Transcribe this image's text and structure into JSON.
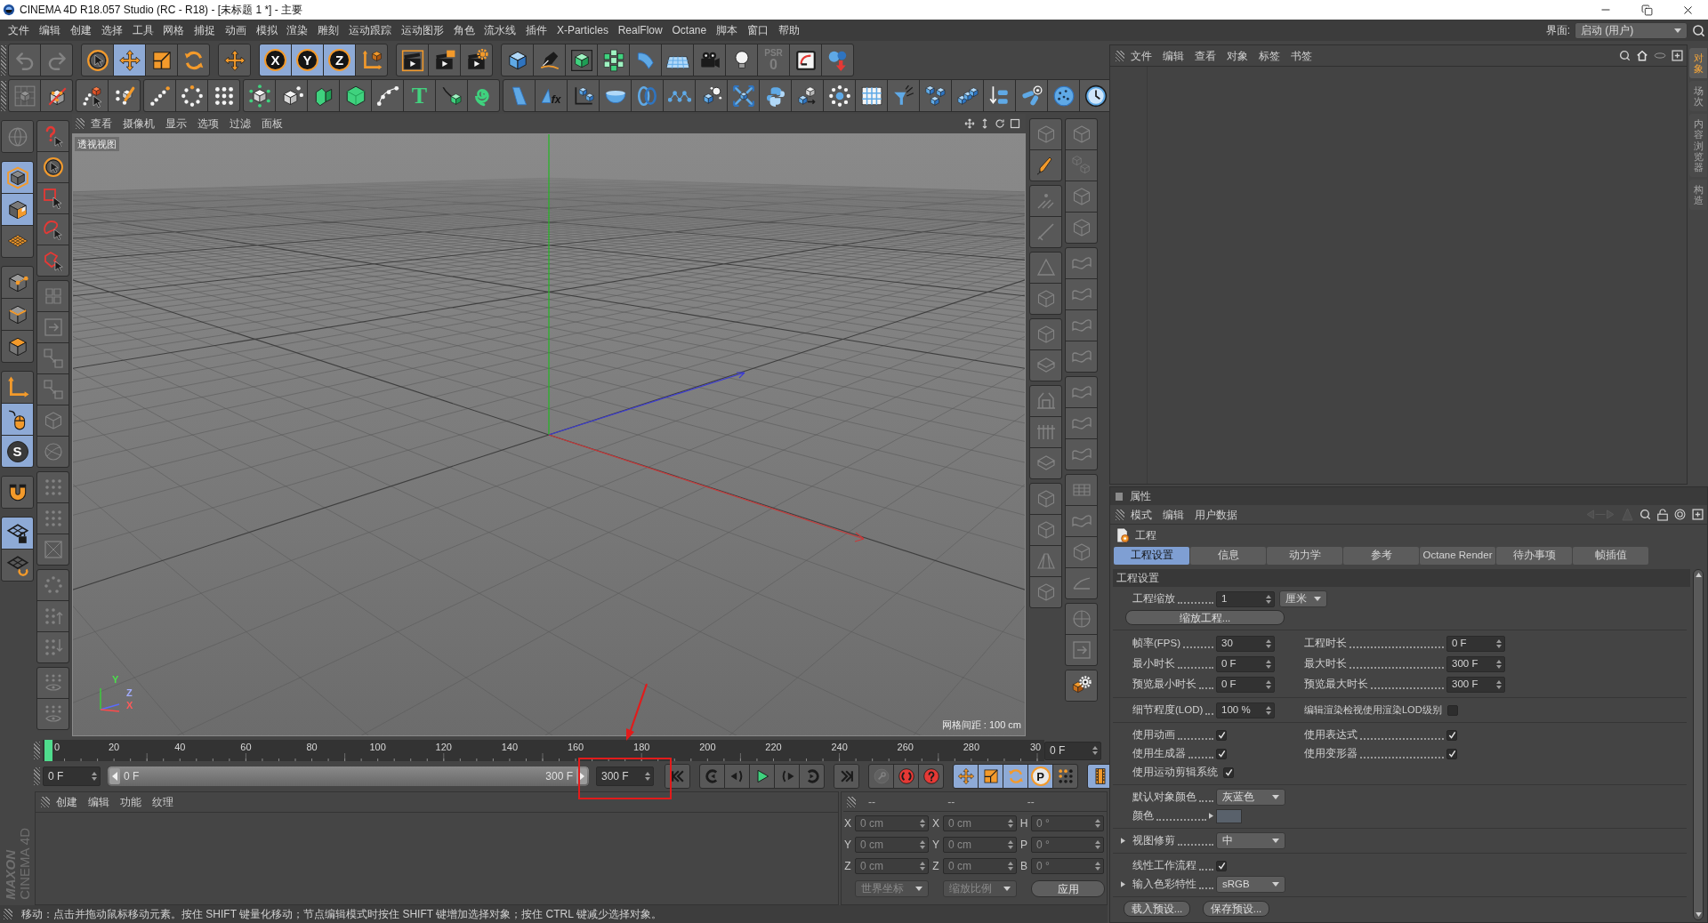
{
  "window": {
    "title": "CINEMA 4D R18.057 Studio (RC - R18) - [未标题 1 *] - 主要"
  },
  "menu_bar": {
    "items": [
      "文件",
      "编辑",
      "创建",
      "选择",
      "工具",
      "网格",
      "捕捉",
      "动画",
      "模拟",
      "渲染",
      "雕刻",
      "运动跟踪",
      "运动图形",
      "角色",
      "流水线",
      "插件",
      "X-Particles",
      "RealFlow",
      "Octane",
      "脚本",
      "窗口",
      "帮助"
    ],
    "layout_label": "界面:",
    "layout_value": "启动 (用户)"
  },
  "toolbar": {
    "row_1": [
      [
        {
          "selected": false,
          "disabled": true
        },
        {
          "selected": false,
          "disabled": true
        }
      ],
      [
        {
          "selected": false,
          "disabled": false
        },
        {
          "selected": true,
          "disabled": false
        },
        {
          "selected": false,
          "disabled": false
        },
        {
          "selected": false,
          "disabled": false
        }
      ],
      [
        {
          "selected": false,
          "disabled": false
        }
      ],
      [
        {
          "label": "X",
          "selected": true,
          "disabled": false
        },
        {
          "label": "Y",
          "selected": true,
          "disabled": false
        },
        {
          "label": "Z",
          "selected": true,
          "disabled": false
        },
        {
          "selected": false,
          "disabled": false
        }
      ],
      [
        {
          "selected": false,
          "disabled": false
        },
        {
          "selected": false,
          "disabled": false
        },
        {
          "selected": false,
          "disabled": false
        }
      ],
      [
        {
          "selected": false,
          "disabled": false
        },
        {
          "selected": false,
          "disabled": false
        },
        {
          "selected": false,
          "disabled": false
        },
        {
          "selected": false,
          "disabled": false
        },
        {
          "selected": false,
          "disabled": false
        },
        {
          "selected": false,
          "disabled": false
        },
        {
          "selected": false,
          "disabled": false
        },
        {
          "selected": false,
          "disabled": false
        },
        {
          "label": "PSR",
          "sub_label": "0",
          "selected": false,
          "disabled": true
        },
        {
          "selected": false,
          "disabled": false
        },
        {
          "selected": false,
          "disabled": false
        }
      ]
    ],
    "row_2": [
      [
        {
          "selected": false,
          "disabled": true
        },
        {
          "selected": false,
          "disabled": false
        }
      ],
      [
        {
          "selected": false,
          "disabled": false
        },
        {
          "selected": false,
          "disabled": false
        }
      ],
      [
        {
          "selected": false,
          "disabled": false
        },
        {
          "selected": false,
          "disabled": false
        },
        {
          "selected": false,
          "disabled": false
        }
      ],
      [
        {
          "selected": false,
          "disabled": false
        },
        {
          "selected": false,
          "disabled": false
        },
        {
          "selected": false,
          "disabled": false
        },
        {
          "selected": false,
          "disabled": false
        },
        {
          "selected": false,
          "disabled": false
        },
        {
          "label": "T",
          "selected": false,
          "disabled": false
        },
        {
          "selected": false,
          "disabled": false
        },
        {
          "selected": false,
          "disabled": false
        }
      ],
      [
        {
          "selected": false,
          "disabled": false
        },
        {
          "label": "fx",
          "selected": false,
          "disabled": false
        },
        {
          "selected": false,
          "disabled": false
        },
        {
          "selected": false,
          "disabled": false
        },
        {
          "selected": false,
          "disabled": false
        },
        {
          "selected": false,
          "disabled": false
        },
        {
          "selected": false,
          "disabled": false
        },
        {
          "selected": false,
          "disabled": false
        },
        {
          "selected": false,
          "disabled": false
        },
        {
          "selected": false,
          "disabled": false
        },
        {
          "selected": false,
          "disabled": false
        },
        {
          "selected": false,
          "disabled": false
        },
        {
          "selected": false,
          "disabled": false
        },
        {
          "selected": false,
          "disabled": false
        },
        {
          "selected": false,
          "disabled": false
        },
        {
          "selected": false,
          "disabled": false
        },
        {
          "selected": false,
          "disabled": false
        },
        {
          "selected": false,
          "disabled": false
        },
        {
          "selected": false,
          "disabled": false
        }
      ]
    ]
  },
  "left_tools": {
    "column_1": [
      [
        {
          "selected": false,
          "disabled": true
        }
      ],
      [
        {
          "selected": true,
          "disabled": false
        },
        {
          "selected": true,
          "disabled": false
        },
        {
          "selected": false,
          "disabled": false
        }
      ],
      [
        {
          "selected": false,
          "disabled": false
        },
        {
          "selected": false,
          "disabled": false
        },
        {
          "selected": false,
          "disabled": false
        }
      ],
      [
        {
          "selected": false,
          "disabled": false
        },
        {
          "selected": true,
          "disabled": false
        },
        {
          "label": "S",
          "selected": true,
          "disabled": false
        }
      ],
      [
        {
          "selected": false,
          "disabled": false
        }
      ],
      [
        {
          "selected": true,
          "disabled": false
        },
        {
          "selected": false,
          "disabled": false
        }
      ]
    ],
    "column_2": [
      [
        {
          "selected": false,
          "disabled": false
        },
        {
          "selected": false,
          "disabled": false
        },
        {
          "selected": false,
          "disabled": false
        },
        {
          "selected": false,
          "disabled": false
        },
        {
          "selected": false,
          "disabled": false
        }
      ],
      [
        {
          "selected": false,
          "disabled": true
        },
        {
          "selected": false,
          "disabled": true
        },
        {
          "selected": false,
          "disabled": true
        },
        {
          "selected": false,
          "disabled": true
        },
        {
          "selected": false,
          "disabled": true
        },
        {
          "selected": false,
          "disabled": true
        }
      ],
      [
        {
          "selected": false,
          "disabled": true
        },
        {
          "selected": false,
          "disabled": true
        },
        {
          "selected": false,
          "disabled": true
        }
      ],
      [
        {
          "selected": false,
          "disabled": true
        },
        {
          "selected": false,
          "disabled": true
        },
        {
          "selected": false,
          "disabled": true
        }
      ],
      [
        {
          "selected": false,
          "disabled": true
        },
        {
          "selected": false,
          "disabled": true
        }
      ]
    ]
  },
  "viewport": {
    "menu": [
      "查看",
      "摄像机",
      "显示",
      "选项",
      "过滤",
      "面板"
    ],
    "view_name": "透视视图",
    "grid_spacing": "网格间距 : 100 cm",
    "axis_labels": [
      "Y",
      "Z",
      "X"
    ]
  },
  "viewport_tools": {
    "column_1": [
      [
        {
          "selected": false,
          "disabled": true
        },
        {
          "selected": false,
          "disabled": false
        }
      ],
      [
        {
          "selected": false,
          "disabled": true
        },
        {
          "selected": false,
          "disabled": true
        }
      ],
      [
        {
          "selected": false,
          "disabled": true
        },
        {
          "selected": false,
          "disabled": true
        }
      ],
      [
        {
          "selected": false,
          "disabled": true
        },
        {
          "selected": false,
          "disabled": true
        }
      ],
      [
        {
          "selected": false,
          "disabled": true
        },
        {
          "selected": false,
          "disabled": true
        },
        {
          "selected": false,
          "disabled": true
        }
      ],
      [
        {
          "selected": false,
          "disabled": true
        },
        {
          "selected": false,
          "disabled": true
        },
        {
          "selected": false,
          "disabled": true
        },
        {
          "selected": false,
          "disabled": true
        }
      ]
    ],
    "column_2": [
      [
        {
          "selected": false,
          "disabled": true
        },
        {
          "selected": false,
          "disabled": true
        },
        {
          "selected": false,
          "disabled": true
        },
        {
          "selected": false,
          "disabled": true
        }
      ],
      [
        {
          "selected": false,
          "disabled": true
        },
        {
          "selected": false,
          "disabled": true
        },
        {
          "selected": false,
          "disabled": true
        },
        {
          "selected": false,
          "disabled": true
        }
      ],
      [
        {
          "selected": false,
          "disabled": true
        },
        {
          "selected": false,
          "disabled": true
        },
        {
          "selected": false,
          "disabled": true
        }
      ],
      [
        {
          "selected": false,
          "disabled": true
        },
        {
          "selected": false,
          "disabled": true
        },
        {
          "selected": false,
          "disabled": true
        },
        {
          "selected": false,
          "disabled": true
        }
      ],
      [
        {
          "selected": false,
          "disabled": true
        },
        {
          "selected": false,
          "disabled": true
        }
      ],
      [
        {
          "selected": false,
          "disabled": false
        }
      ]
    ]
  },
  "timeline": {
    "ticks": [
      "0",
      "20",
      "40",
      "60",
      "80",
      "100",
      "120",
      "140",
      "160",
      "180",
      "200",
      "220",
      "240",
      "260",
      "280",
      "30"
    ],
    "level": 0,
    "current_frame": "0 F",
    "start_frame": "0 F",
    "range": {
      "start": "0 F",
      "end": "300 F",
      "level": 1
    },
    "end_frame": "300 F",
    "transport": [
      [
        {
          "selected": false,
          "disabled": false
        }
      ],
      [
        {
          "selected": false,
          "disabled": false
        },
        {
          "selected": false,
          "disabled": false
        },
        {
          "selected": false,
          "disabled": false
        },
        {
          "selected": false,
          "disabled": false
        },
        {
          "selected": false,
          "disabled": false
        }
      ],
      [
        {
          "selected": false,
          "disabled": false
        }
      ],
      [
        {
          "selected": false,
          "disabled": true
        },
        {
          "selected": false,
          "disabled": false
        },
        {
          "selected": false,
          "disabled": false
        }
      ],
      [
        {
          "selected": true,
          "disabled": false
        },
        {
          "selected": true,
          "disabled": false
        },
        {
          "selected": true,
          "disabled": false
        },
        {
          "label": "P",
          "selected": true,
          "disabled": false
        },
        {
          "selected": false,
          "disabled": false
        }
      ],
      [
        {
          "selected": true,
          "disabled": false
        }
      ]
    ]
  },
  "material_manager": {
    "menu": [
      "创建",
      "编辑",
      "功能",
      "纹理"
    ]
  },
  "coordinates": {
    "headers": [
      "--",
      "--",
      "--"
    ],
    "rows": [
      {
        "position_axis": "X",
        "position": "0 cm",
        "size_axis": "X",
        "size": "0 cm",
        "rotation_axis": "H",
        "rotation": "0 °"
      },
      {
        "position_axis": "Y",
        "position": "0 cm",
        "size_axis": "Y",
        "size": "0 cm",
        "rotation_axis": "P",
        "rotation": "0 °"
      },
      {
        "position_axis": "Z",
        "position": "0 cm",
        "size_axis": "Z",
        "size": "0 cm",
        "rotation_axis": "B",
        "rotation": "0 °"
      }
    ],
    "coordinate_system": {
      "value": "世界坐标",
      "disabled": true
    },
    "size_mode": {
      "value": "缩放比例",
      "disabled": true
    },
    "apply": "应用"
  },
  "logo": {
    "brand": "MAXON",
    "product": "CINEMA 4D"
  },
  "status_bar": {
    "text": "移动：点击并拖动鼠标移动元素。按住 SHIFT 键量化移动；节点编辑模式时按住 SHIFT 键增加选择对象；按住 CTRL 键减少选择对象。"
  },
  "object_manager": {
    "menu": [
      "文件",
      "编辑",
      "查看",
      "对象",
      "标签",
      "书签"
    ]
  },
  "side_tabs": [
    {
      "label": "对象",
      "selected": true
    },
    {
      "label": "场次",
      "selected": false
    },
    {
      "label": "内容浏览器",
      "selected": false
    },
    {
      "label": "构造",
      "selected": false
    }
  ],
  "attributes": {
    "title": "属性",
    "menu": [
      "模式",
      "编辑",
      "用户数据"
    ],
    "object": "工程",
    "tabs": [
      {
        "label": "工程设置",
        "selected": true
      },
      {
        "label": "信息",
        "selected": false
      },
      {
        "label": "动力学",
        "selected": false
      },
      {
        "label": "参考",
        "selected": false
      },
      {
        "label": "Octane Render",
        "selected": false
      },
      {
        "label": "待办事项",
        "selected": false
      },
      {
        "label": "帧插值",
        "selected": false
      }
    ],
    "section": "工程设置",
    "project_scale": {
      "label": "工程缩放",
      "value": "1",
      "unit": "厘米"
    },
    "scale_button": "缩放工程...",
    "time_fields": [
      {
        "label": "帧率(FPS)",
        "value": "30"
      },
      {
        "label": "工程时长",
        "value": "0 F"
      },
      {
        "label": "最小时长",
        "value": "0 F"
      },
      {
        "label": "最大时长",
        "value": "300 F"
      },
      {
        "label": "预览最小时长",
        "value": "0 F"
      },
      {
        "label": "预览最大时长",
        "value": "300 F"
      }
    ],
    "lod": {
      "label": "细节程度(LOD)",
      "value": "100 %"
    },
    "lod_option": {
      "label": "编辑渲染检视使用渲染LOD级别",
      "checked": false
    },
    "options": [
      {
        "label": "使用动画",
        "checked": true
      },
      {
        "label": "使用表达式",
        "checked": true
      },
      {
        "label": "使用生成器",
        "checked": true
      },
      {
        "label": "使用变形器",
        "checked": true
      },
      {
        "label": "使用运动剪辑系统",
        "checked": true
      }
    ],
    "default_object_color": {
      "label": "默认对象颜色",
      "value": "灰蓝色"
    },
    "color": {
      "label": "颜色",
      "color": "#59616b",
      "expanded": false
    },
    "view_clipping": {
      "label": "视图修剪",
      "value": "中",
      "expanded": false
    },
    "linear_workflow": {
      "label": "线性工作流程",
      "checked": true
    },
    "input_color_profile": {
      "label": "输入色彩特性",
      "value": "sRGB",
      "expanded": false
    },
    "presets": [
      "载入预设...",
      "保存预设..."
    ]
  }
}
